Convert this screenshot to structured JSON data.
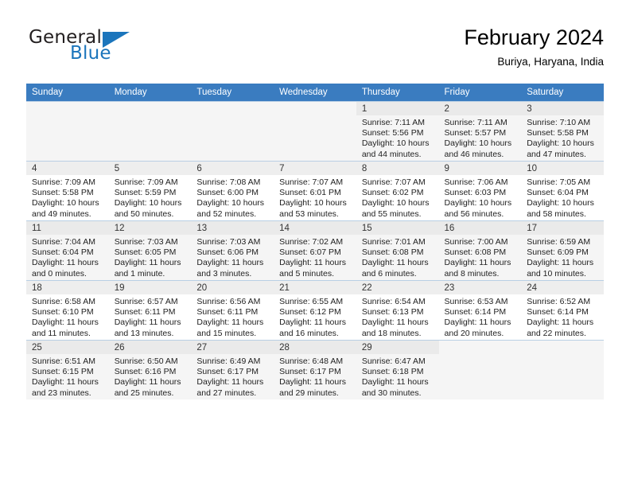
{
  "brand": {
    "name_line1": "General",
    "name_line2": "Blue",
    "logo_icon": "triangle-logo-icon",
    "colors": {
      "blue": "#1b75bc",
      "dark": "#231f20"
    }
  },
  "header": {
    "month_title": "February 2024",
    "location": "Buriya, Haryana, India"
  },
  "calendar": {
    "header_bg": "#3a7cc0",
    "weekdays": [
      "Sunday",
      "Monday",
      "Tuesday",
      "Wednesday",
      "Thursday",
      "Friday",
      "Saturday"
    ],
    "weeks": [
      [
        {
          "day": "",
          "sunrise": "",
          "sunset": "",
          "daylight1": "",
          "daylight2": ""
        },
        {
          "day": "",
          "sunrise": "",
          "sunset": "",
          "daylight1": "",
          "daylight2": ""
        },
        {
          "day": "",
          "sunrise": "",
          "sunset": "",
          "daylight1": "",
          "daylight2": ""
        },
        {
          "day": "",
          "sunrise": "",
          "sunset": "",
          "daylight1": "",
          "daylight2": ""
        },
        {
          "day": "1",
          "sunrise": "Sunrise: 7:11 AM",
          "sunset": "Sunset: 5:56 PM",
          "daylight1": "Daylight: 10 hours",
          "daylight2": "and 44 minutes."
        },
        {
          "day": "2",
          "sunrise": "Sunrise: 7:11 AM",
          "sunset": "Sunset: 5:57 PM",
          "daylight1": "Daylight: 10 hours",
          "daylight2": "and 46 minutes."
        },
        {
          "day": "3",
          "sunrise": "Sunrise: 7:10 AM",
          "sunset": "Sunset: 5:58 PM",
          "daylight1": "Daylight: 10 hours",
          "daylight2": "and 47 minutes."
        }
      ],
      [
        {
          "day": "4",
          "sunrise": "Sunrise: 7:09 AM",
          "sunset": "Sunset: 5:58 PM",
          "daylight1": "Daylight: 10 hours",
          "daylight2": "and 49 minutes."
        },
        {
          "day": "5",
          "sunrise": "Sunrise: 7:09 AM",
          "sunset": "Sunset: 5:59 PM",
          "daylight1": "Daylight: 10 hours",
          "daylight2": "and 50 minutes."
        },
        {
          "day": "6",
          "sunrise": "Sunrise: 7:08 AM",
          "sunset": "Sunset: 6:00 PM",
          "daylight1": "Daylight: 10 hours",
          "daylight2": "and 52 minutes."
        },
        {
          "day": "7",
          "sunrise": "Sunrise: 7:07 AM",
          "sunset": "Sunset: 6:01 PM",
          "daylight1": "Daylight: 10 hours",
          "daylight2": "and 53 minutes."
        },
        {
          "day": "8",
          "sunrise": "Sunrise: 7:07 AM",
          "sunset": "Sunset: 6:02 PM",
          "daylight1": "Daylight: 10 hours",
          "daylight2": "and 55 minutes."
        },
        {
          "day": "9",
          "sunrise": "Sunrise: 7:06 AM",
          "sunset": "Sunset: 6:03 PM",
          "daylight1": "Daylight: 10 hours",
          "daylight2": "and 56 minutes."
        },
        {
          "day": "10",
          "sunrise": "Sunrise: 7:05 AM",
          "sunset": "Sunset: 6:04 PM",
          "daylight1": "Daylight: 10 hours",
          "daylight2": "and 58 minutes."
        }
      ],
      [
        {
          "day": "11",
          "sunrise": "Sunrise: 7:04 AM",
          "sunset": "Sunset: 6:04 PM",
          "daylight1": "Daylight: 11 hours",
          "daylight2": "and 0 minutes."
        },
        {
          "day": "12",
          "sunrise": "Sunrise: 7:03 AM",
          "sunset": "Sunset: 6:05 PM",
          "daylight1": "Daylight: 11 hours",
          "daylight2": "and 1 minute."
        },
        {
          "day": "13",
          "sunrise": "Sunrise: 7:03 AM",
          "sunset": "Sunset: 6:06 PM",
          "daylight1": "Daylight: 11 hours",
          "daylight2": "and 3 minutes."
        },
        {
          "day": "14",
          "sunrise": "Sunrise: 7:02 AM",
          "sunset": "Sunset: 6:07 PM",
          "daylight1": "Daylight: 11 hours",
          "daylight2": "and 5 minutes."
        },
        {
          "day": "15",
          "sunrise": "Sunrise: 7:01 AM",
          "sunset": "Sunset: 6:08 PM",
          "daylight1": "Daylight: 11 hours",
          "daylight2": "and 6 minutes."
        },
        {
          "day": "16",
          "sunrise": "Sunrise: 7:00 AM",
          "sunset": "Sunset: 6:08 PM",
          "daylight1": "Daylight: 11 hours",
          "daylight2": "and 8 minutes."
        },
        {
          "day": "17",
          "sunrise": "Sunrise: 6:59 AM",
          "sunset": "Sunset: 6:09 PM",
          "daylight1": "Daylight: 11 hours",
          "daylight2": "and 10 minutes."
        }
      ],
      [
        {
          "day": "18",
          "sunrise": "Sunrise: 6:58 AM",
          "sunset": "Sunset: 6:10 PM",
          "daylight1": "Daylight: 11 hours",
          "daylight2": "and 11 minutes."
        },
        {
          "day": "19",
          "sunrise": "Sunrise: 6:57 AM",
          "sunset": "Sunset: 6:11 PM",
          "daylight1": "Daylight: 11 hours",
          "daylight2": "and 13 minutes."
        },
        {
          "day": "20",
          "sunrise": "Sunrise: 6:56 AM",
          "sunset": "Sunset: 6:11 PM",
          "daylight1": "Daylight: 11 hours",
          "daylight2": "and 15 minutes."
        },
        {
          "day": "21",
          "sunrise": "Sunrise: 6:55 AM",
          "sunset": "Sunset: 6:12 PM",
          "daylight1": "Daylight: 11 hours",
          "daylight2": "and 16 minutes."
        },
        {
          "day": "22",
          "sunrise": "Sunrise: 6:54 AM",
          "sunset": "Sunset: 6:13 PM",
          "daylight1": "Daylight: 11 hours",
          "daylight2": "and 18 minutes."
        },
        {
          "day": "23",
          "sunrise": "Sunrise: 6:53 AM",
          "sunset": "Sunset: 6:14 PM",
          "daylight1": "Daylight: 11 hours",
          "daylight2": "and 20 minutes."
        },
        {
          "day": "24",
          "sunrise": "Sunrise: 6:52 AM",
          "sunset": "Sunset: 6:14 PM",
          "daylight1": "Daylight: 11 hours",
          "daylight2": "and 22 minutes."
        }
      ],
      [
        {
          "day": "25",
          "sunrise": "Sunrise: 6:51 AM",
          "sunset": "Sunset: 6:15 PM",
          "daylight1": "Daylight: 11 hours",
          "daylight2": "and 23 minutes."
        },
        {
          "day": "26",
          "sunrise": "Sunrise: 6:50 AM",
          "sunset": "Sunset: 6:16 PM",
          "daylight1": "Daylight: 11 hours",
          "daylight2": "and 25 minutes."
        },
        {
          "day": "27",
          "sunrise": "Sunrise: 6:49 AM",
          "sunset": "Sunset: 6:17 PM",
          "daylight1": "Daylight: 11 hours",
          "daylight2": "and 27 minutes."
        },
        {
          "day": "28",
          "sunrise": "Sunrise: 6:48 AM",
          "sunset": "Sunset: 6:17 PM",
          "daylight1": "Daylight: 11 hours",
          "daylight2": "and 29 minutes."
        },
        {
          "day": "29",
          "sunrise": "Sunrise: 6:47 AM",
          "sunset": "Sunset: 6:18 PM",
          "daylight1": "Daylight: 11 hours",
          "daylight2": "and 30 minutes."
        },
        {
          "day": "",
          "sunrise": "",
          "sunset": "",
          "daylight1": "",
          "daylight2": ""
        },
        {
          "day": "",
          "sunrise": "",
          "sunset": "",
          "daylight1": "",
          "daylight2": ""
        }
      ]
    ]
  }
}
